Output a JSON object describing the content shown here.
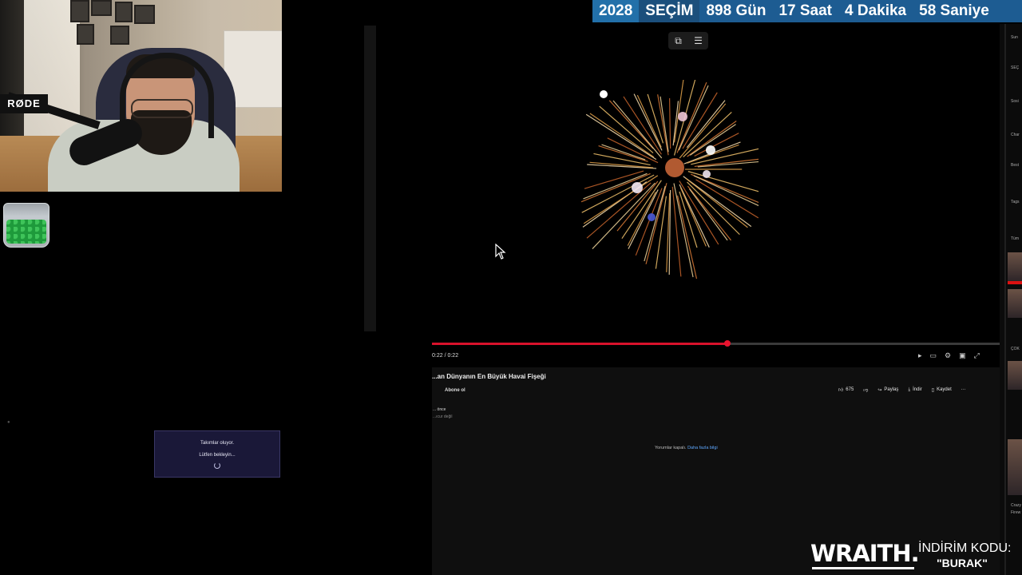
{
  "overlay": {
    "countdown": {
      "year": "2028",
      "election": "SEÇİM",
      "days": "898 Gün",
      "hours": "17 Saat",
      "minutes": "4  Dakika",
      "seconds": "58 Saniye"
    },
    "mic_brand": "RØDE",
    "alert": {
      "line1": "Takımlar oluyor.",
      "line2": "Lütfen bekleyin..."
    },
    "sponsor": {
      "logo": "WRAITH.",
      "discount_label": "İNDİRİM KODU:",
      "discount_code": "\"BURAK\""
    }
  },
  "player": {
    "time": "0:22 / 0:22",
    "progress": 0.52,
    "toolbar_icons": [
      "pip-icon",
      "notes-icon"
    ],
    "control_icons": [
      "play-icon",
      "subtitles-icon",
      "settings-icon",
      "theater-icon",
      "fullscreen-icon"
    ]
  },
  "video": {
    "title": "...an Dünyanın En Büyük Havai Fişeği",
    "subscribe_label": "Abone ol",
    "like_count": "675",
    "share_label": "Paylaş",
    "download_label": "İndir",
    "save_label": "Kaydet",
    "meta_line1": "... önce",
    "meta_line2": "...ıcur değil",
    "comments_off": "Yorumlar kapalı.",
    "learn_more": "Daha fazla bilgi"
  },
  "sidebar": {
    "labels": [
      "Sun",
      "SEÇ",
      "Sosi",
      "Char",
      "Best",
      "Tags",
      "Tüm",
      "ÇOK",
      "Crazy",
      "Firew"
    ]
  },
  "colors": {
    "banner": "#1d5c92",
    "progress": "#d9122b",
    "alert_bg": "#1a1838",
    "link": "#5fa8ff"
  }
}
